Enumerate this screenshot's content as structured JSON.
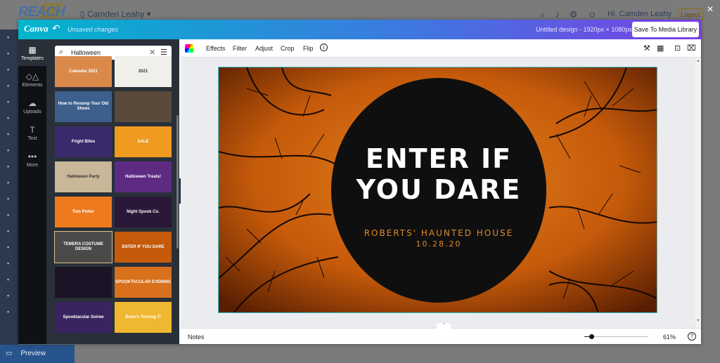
{
  "app": {
    "logo": "REACH",
    "user_select": "Camden Leahy",
    "greeting": "Hi, Camden Leahy",
    "logout": "Logout",
    "preview": "Preview"
  },
  "canva": {
    "logo": "Canva",
    "unsaved": "Unsaved changes",
    "design_title": "Untitled design - 1920px × 1080px",
    "save_button": "Save To Media Library"
  },
  "side_nav": [
    {
      "label": "Templates",
      "icon": "templates-icon",
      "glyph": "▦"
    },
    {
      "label": "Elements",
      "icon": "elements-icon",
      "glyph": "◇△"
    },
    {
      "label": "Uploads",
      "icon": "uploads-icon",
      "glyph": "☁"
    },
    {
      "label": "Text",
      "icon": "text-icon",
      "glyph": "T"
    },
    {
      "label": "More",
      "icon": "more-icon",
      "glyph": "•••"
    }
  ],
  "search": {
    "value": "Halloween"
  },
  "templates": [
    {
      "text": "Calendar 2021",
      "bg": "#d9894a"
    },
    {
      "text": "2021",
      "bg": "#f0efe9"
    },
    {
      "text": "How to Revamp Your Old Shoes",
      "bg": "#3d5f8c"
    },
    {
      "text": "",
      "bg": "#5a4a3c"
    },
    {
      "text": "Fright Bites",
      "bg": "#3b2a6b"
    },
    {
      "text": "SALE",
      "bg": "#f09a20"
    },
    {
      "text": "Halloween Party",
      "bg": "#c9b79a"
    },
    {
      "text": "Halloween Treats!",
      "bg": "#5e2b82"
    },
    {
      "text": "Tom Potter",
      "bg": "#ee7a1e"
    },
    {
      "text": "Night Spook Co.",
      "bg": "#2b1738"
    },
    {
      "text": "TEMERA COSTUME DESIGN",
      "bg": "#4a4a48"
    },
    {
      "text": "ENTER IF YOU DARE",
      "bg": "#c55a0a"
    },
    {
      "text": "",
      "bg": "#1c1326"
    },
    {
      "text": "SPOOKTACULAR EVENING",
      "bg": "#d8701c"
    },
    {
      "text": "Spooktacular Soiree",
      "bg": "#3a2460"
    },
    {
      "text": "Brian's Turning 7!",
      "bg": "#f0b830"
    }
  ],
  "toolbar": {
    "effects": "Effects",
    "filter": "Filter",
    "adjust": "Adjust",
    "crop": "Crop",
    "flip": "Flip",
    "info": "i"
  },
  "poster": {
    "title_line1": "ENTER IF",
    "title_line2": "YOU DARE",
    "subtitle": "ROBERTS' HAUNTED HOUSE",
    "date": "10.28.20"
  },
  "footer": {
    "notes": "Notes",
    "zoom": "61%",
    "help": "?"
  },
  "colors": {
    "header_gradient_start": "#00b5cc",
    "header_gradient_end": "#7b3fe4",
    "panel": "#293039",
    "poster_orange": "#c55a0a",
    "poster_text_orange": "#e08a2a"
  }
}
